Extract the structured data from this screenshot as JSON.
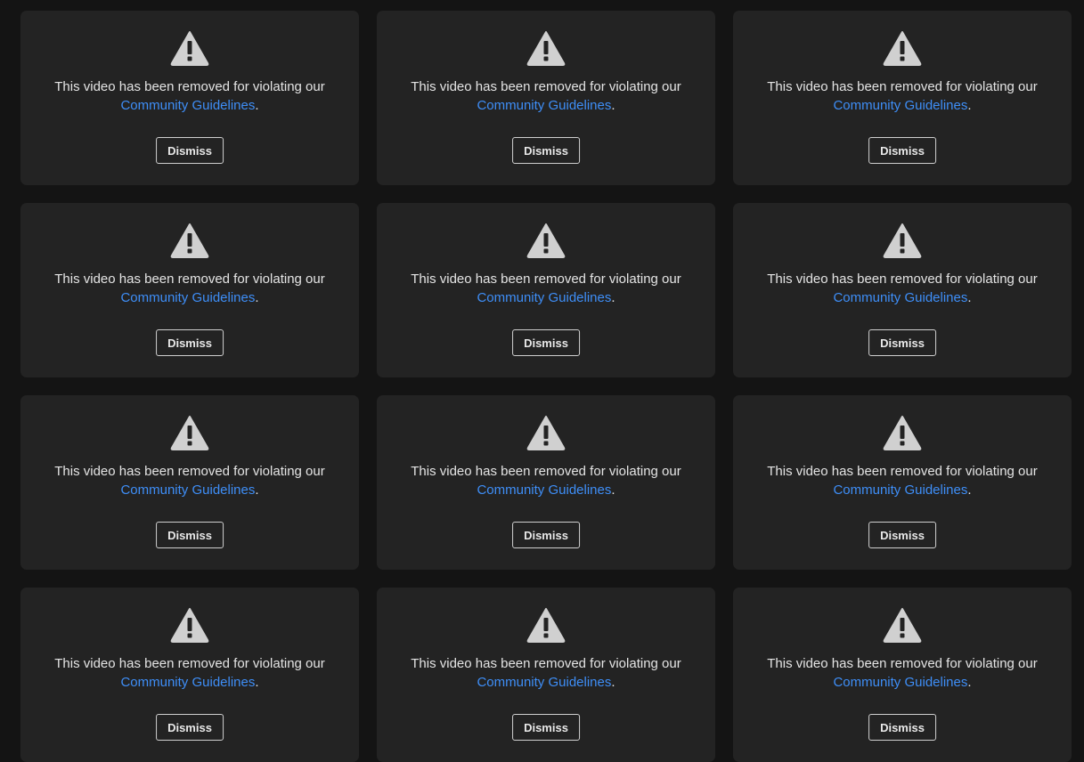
{
  "feed": {
    "cards": [
      {
        "message": "This video has been removed for violating our",
        "link_text": "Community Guidelines",
        "period": ".",
        "dismiss_label": "Dismiss",
        "icon": "warning-triangle-icon"
      },
      {
        "message": "This video has been removed for violating our",
        "link_text": "Community Guidelines",
        "period": ".",
        "dismiss_label": "Dismiss",
        "icon": "warning-triangle-icon"
      },
      {
        "message": "This video has been removed for violating our",
        "link_text": "Community Guidelines",
        "period": ".",
        "dismiss_label": "Dismiss",
        "icon": "warning-triangle-icon"
      },
      {
        "message": "This video has been removed for violating our",
        "link_text": "Community Guidelines",
        "period": ".",
        "dismiss_label": "Dismiss",
        "icon": "warning-triangle-icon"
      },
      {
        "message": "This video has been removed for violating our",
        "link_text": "Community Guidelines",
        "period": ".",
        "dismiss_label": "Dismiss",
        "icon": "warning-triangle-icon"
      },
      {
        "message": "This video has been removed for violating our",
        "link_text": "Community Guidelines",
        "period": ".",
        "dismiss_label": "Dismiss",
        "icon": "warning-triangle-icon"
      },
      {
        "message": "This video has been removed for violating our",
        "link_text": "Community Guidelines",
        "period": ".",
        "dismiss_label": "Dismiss",
        "icon": "warning-triangle-icon"
      },
      {
        "message": "This video has been removed for violating our",
        "link_text": "Community Guidelines",
        "period": ".",
        "dismiss_label": "Dismiss",
        "icon": "warning-triangle-icon"
      },
      {
        "message": "This video has been removed for violating our",
        "link_text": "Community Guidelines",
        "period": ".",
        "dismiss_label": "Dismiss",
        "icon": "warning-triangle-icon"
      },
      {
        "message": "This video has been removed for violating our",
        "link_text": "Community Guidelines",
        "period": ".",
        "dismiss_label": "Dismiss",
        "icon": "warning-triangle-icon"
      },
      {
        "message": "This video has been removed for violating our",
        "link_text": "Community Guidelines",
        "period": ".",
        "dismiss_label": "Dismiss",
        "icon": "warning-triangle-icon"
      },
      {
        "message": "This video has been removed for violating our",
        "link_text": "Community Guidelines",
        "period": ".",
        "dismiss_label": "Dismiss",
        "icon": "warning-triangle-icon"
      }
    ]
  },
  "colors": {
    "page_background": "#141414",
    "card_background": "#232323",
    "link": "#3e8ef7",
    "icon": "#d0d0d0"
  }
}
